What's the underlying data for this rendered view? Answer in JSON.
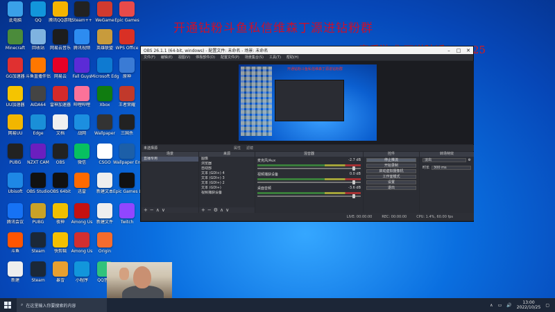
{
  "overlay": {
    "title": "开通钻粉斗鱼私信维森丁源进钻粉群",
    "subtitle": "素质游戏 不说脏话！25/25"
  },
  "desktop_icons": [
    {
      "label": "此电脑",
      "icon": "computer-icon",
      "color": "#3aa0e8"
    },
    {
      "label": "QQ",
      "icon": "qq-icon",
      "color": "#1296db"
    },
    {
      "label": "腾讯QQ游戏",
      "icon": "qqgame-icon",
      "color": "#f4b400"
    },
    {
      "label": "Steam++",
      "icon": "steam-icon",
      "color": "#222"
    },
    {
      "label": "WeGame",
      "icon": "wegame-icon",
      "color": "#d03a2f"
    },
    {
      "label": "Epic Games",
      "icon": "game-icon",
      "color": "#e84a4a"
    },
    {
      "label": "Minecraft",
      "icon": "minecraft-icon",
      "color": "#4b8b3b"
    },
    {
      "label": "回收站",
      "icon": "recycle-bin-icon",
      "color": "#7fb3e0"
    },
    {
      "label": "网易云音乐",
      "icon": "netease-icon",
      "color": "#1d1d1d"
    },
    {
      "label": "腾讯视频",
      "icon": "video-icon",
      "color": "#2d8cf0"
    },
    {
      "label": "英雄联盟",
      "icon": "lol-icon",
      "color": "#c89b3c"
    },
    {
      "label": "WPS Office",
      "icon": "wps-icon",
      "color": "#d93025"
    },
    {
      "label": "GG加速器",
      "icon": "gg-icon",
      "color": "#e03030"
    },
    {
      "label": "斗鱼直播伴侣",
      "icon": "douyu-icon",
      "color": "#ff7700"
    },
    {
      "label": "网易云",
      "icon": "music-icon",
      "color": "#e60026"
    },
    {
      "label": "Fall Guys",
      "icon": "fallguys-icon",
      "color": "#5b2bd6"
    },
    {
      "label": "Microsoft Edge",
      "icon": "edge-icon",
      "color": "#0e7ad1"
    },
    {
      "label": "原神",
      "icon": "genshin-icon",
      "color": "#3a7bd5"
    },
    {
      "label": "UU加速器",
      "icon": "uu-icon",
      "color": "#f5c400"
    },
    {
      "label": "AIDA64",
      "icon": "aida-icon",
      "color": "#444"
    },
    {
      "label": "雷神加速器",
      "icon": "leishen-icon",
      "color": "#d42a2a"
    },
    {
      "label": "哔哩哔哩",
      "icon": "bilibili-icon",
      "color": "#fb7299"
    },
    {
      "label": "Xbox",
      "icon": "xbox-icon",
      "color": "#107c10"
    },
    {
      "label": "王者荣耀",
      "icon": "honor-icon",
      "color": "#c1392b"
    },
    {
      "label": "网易UU",
      "icon": "uu2-icon",
      "color": "#f2b600"
    },
    {
      "label": "Edge",
      "icon": "edge2-icon",
      "color": "#1a8fd8"
    },
    {
      "label": "文档",
      "icon": "document-icon",
      "color": "#f0f0f0"
    },
    {
      "label": "战网",
      "icon": "battlenet-icon",
      "color": "#1c8fe0"
    },
    {
      "label": "Wallpaper",
      "icon": "wallpaper-icon",
      "color": "#333"
    },
    {
      "label": "三国杀",
      "icon": "sgs-icon",
      "color": "#222"
    },
    {
      "label": "PUBG",
      "icon": "pubg-icon",
      "color": "#222"
    },
    {
      "label": "NZXT CAM",
      "icon": "nzxt-icon",
      "color": "#6b1fbf"
    },
    {
      "label": "OBS",
      "icon": "obs-icon",
      "color": "#222"
    },
    {
      "label": "微信",
      "icon": "wechat-icon",
      "color": "#07c160"
    },
    {
      "label": "CSGO",
      "icon": "csgo-icon",
      "color": "#ffffff"
    },
    {
      "label": "Wallpaper Engine",
      "icon": "we-icon",
      "color": "#1c5fa8"
    },
    {
      "label": "Ubisoft",
      "icon": "ubisoft-icon",
      "color": "#1e88e5"
    },
    {
      "label": "OBS Studio",
      "icon": "obs2-icon",
      "color": "#111"
    },
    {
      "label": "OBS 64bit",
      "icon": "obs3-icon",
      "color": "#111"
    },
    {
      "label": "迅雷",
      "icon": "xunlei-icon",
      "color": "#ff6a00"
    },
    {
      "label": "新建文本",
      "icon": "text-icon",
      "color": "#eeeeee"
    },
    {
      "label": "Epic Games Launcher",
      "icon": "epic-icon",
      "color": "#111"
    },
    {
      "label": "腾讯会议",
      "icon": "meeting-icon",
      "color": "#1672f5"
    },
    {
      "label": "PUBG",
      "icon": "pubg2-icon",
      "color": "#c9a227"
    },
    {
      "label": "夜神",
      "icon": "nox-icon",
      "color": "#f0c000"
    },
    {
      "label": "Among Us",
      "icon": "amongus-icon",
      "color": "#c51111"
    },
    {
      "label": "新建文件",
      "icon": "file-icon",
      "color": "#eeeeee"
    },
    {
      "label": "Twitch",
      "icon": "twitch-icon",
      "color": "#9146ff"
    },
    {
      "label": "斗鱼",
      "icon": "douyu2-icon",
      "color": "#ff5500"
    },
    {
      "label": "Steam",
      "icon": "steam2-icon",
      "color": "#1b2838"
    },
    {
      "label": "快剪辑",
      "icon": "clip-icon",
      "color": "#f5c000"
    },
    {
      "label": "Among Us",
      "icon": "amongus2-icon",
      "color": "#d32f2f"
    },
    {
      "label": "Origin",
      "icon": "origin-icon",
      "color": "#f56c2d"
    },
    {
      "label": "新建",
      "icon": "newfile-icon",
      "color": "#eeeeee"
    },
    {
      "label": "Steam",
      "icon": "steam3-icon",
      "color": "#1b2838"
    },
    {
      "label": "暴雪",
      "icon": "blizzard-icon",
      "color": "#e8a030"
    },
    {
      "label": "小程序",
      "icon": "mini-icon",
      "color": "#1296db"
    },
    {
      "label": "QQ音乐",
      "icon": "qqmusic-icon",
      "color": "#31c27c"
    },
    {
      "label": "糖豆人",
      "icon": "tdr-icon",
      "color": "#ffb300"
    },
    {
      "label": "英雄联盟",
      "icon": "lol2-icon",
      "color": "#c89b3c"
    }
  ],
  "obs": {
    "title": "OBS 26.1.1 (64-bit, windows) - 配置文件: 未命名 - 场景: 未命名",
    "menu": [
      "文件(F)",
      "编辑(E)",
      "视图(V)",
      "停靠部件(D)",
      "配置文件(P)",
      "场景集合(S)",
      "工具(T)",
      "帮助(H)"
    ],
    "preview_caption": "开通钻粉斗鱼私信维森丁源进钻粉群",
    "scene_bar_label": "未选择源",
    "scene_bar_modes": [
      "属性",
      "滤镜"
    ],
    "docks": {
      "scenes": {
        "title": "场景",
        "items": [
          "直播专用"
        ]
      },
      "sources": {
        "title": "来源",
        "items": [
          "图像",
          "浏览器",
          "自动部",
          "文本 (GDI+) 4",
          "文本 (GDI+) 3",
          "文本 (GDI+) 2",
          "文本 (GDI+)",
          "视频捕获设备"
        ]
      },
      "mixer": {
        "title": "混音器",
        "channels": [
          {
            "name": "麦克风/Aux",
            "db": "-2.7 dB"
          },
          {
            "name": "视频捕获设备",
            "db": "0.0 dB"
          },
          {
            "name": "桌面音频",
            "db": "-3.6 dB"
          }
        ]
      },
      "controls": {
        "title": "控件",
        "buttons": [
          "停止推流",
          "开始录制",
          "启动虚拟摄像机",
          "工作室模式",
          "设置",
          "退出"
        ]
      },
      "transitions": {
        "title": "转场特效",
        "type": "淡出",
        "duration_label": "时长",
        "duration": "300 ms"
      }
    },
    "status": {
      "live": "LIVE: 00:00:00",
      "rec": "REC: 00:00:00",
      "cpu": "CPU: 1.4%, 60.00 fps"
    }
  },
  "taskbar": {
    "search_placeholder": "在这里输入你要搜索的内容",
    "time": "13:00",
    "date": "2022/10/25"
  }
}
